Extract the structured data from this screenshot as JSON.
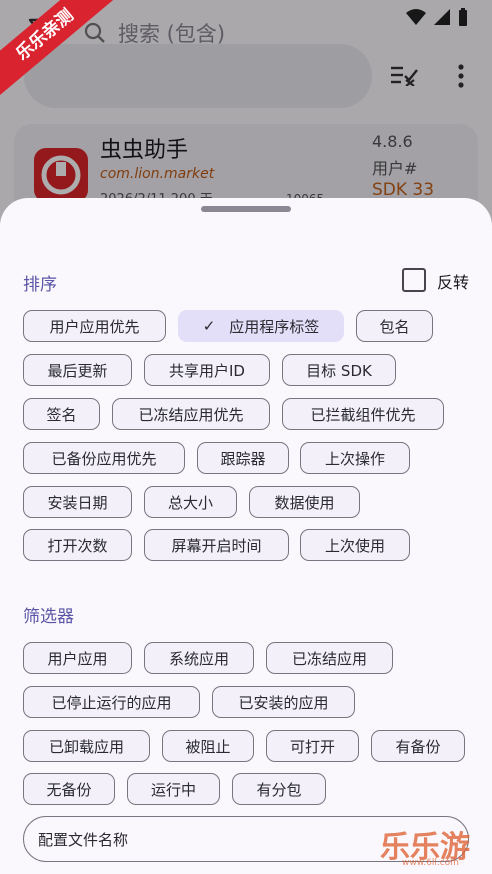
{
  "watermark_corner": "乐乐亲测",
  "toolbar": {
    "search_placeholder": "搜索 (包含)"
  },
  "app_item": {
    "name": "虫虫助手",
    "package": "com.lion.market",
    "date": "2026/2/11 200 天",
    "uid": "10065",
    "version": "4.8.6",
    "user": "用户#",
    "sdk": "SDK 33"
  },
  "sort": {
    "title": "排序",
    "reverse_label": "反转",
    "chips": [
      {
        "label": "用户应用优先"
      },
      {
        "label": "应用程序标签",
        "selected": true
      },
      {
        "label": "包名"
      },
      {
        "label": "最后更新"
      },
      {
        "label": "共享用户ID"
      },
      {
        "label": "目标 SDK"
      },
      {
        "label": "签名"
      },
      {
        "label": "已冻结应用优先"
      },
      {
        "label": "已拦截组件优先"
      },
      {
        "label": "已备份应用优先"
      },
      {
        "label": "跟踪器"
      },
      {
        "label": "上次操作"
      },
      {
        "label": "安装日期"
      },
      {
        "label": "总大小"
      },
      {
        "label": "数据使用"
      },
      {
        "label": "打开次数"
      },
      {
        "label": "屏幕开启时间"
      },
      {
        "label": "上次使用"
      }
    ]
  },
  "filter": {
    "title": "筛选器",
    "chips": [
      {
        "label": "用户应用"
      },
      {
        "label": "系统应用"
      },
      {
        "label": "已冻结应用"
      },
      {
        "label": "已停止运行的应用"
      },
      {
        "label": "已安装的应用"
      },
      {
        "label": "已卸载应用"
      },
      {
        "label": "被阻止"
      },
      {
        "label": "可打开"
      },
      {
        "label": "有备份"
      },
      {
        "label": "无备份"
      },
      {
        "label": "运行中"
      },
      {
        "label": "有分包"
      }
    ]
  },
  "profile": {
    "label": "配置文件名称"
  },
  "watermark": {
    "brand": "乐乐游戏",
    "url": "www.6ll.com"
  }
}
